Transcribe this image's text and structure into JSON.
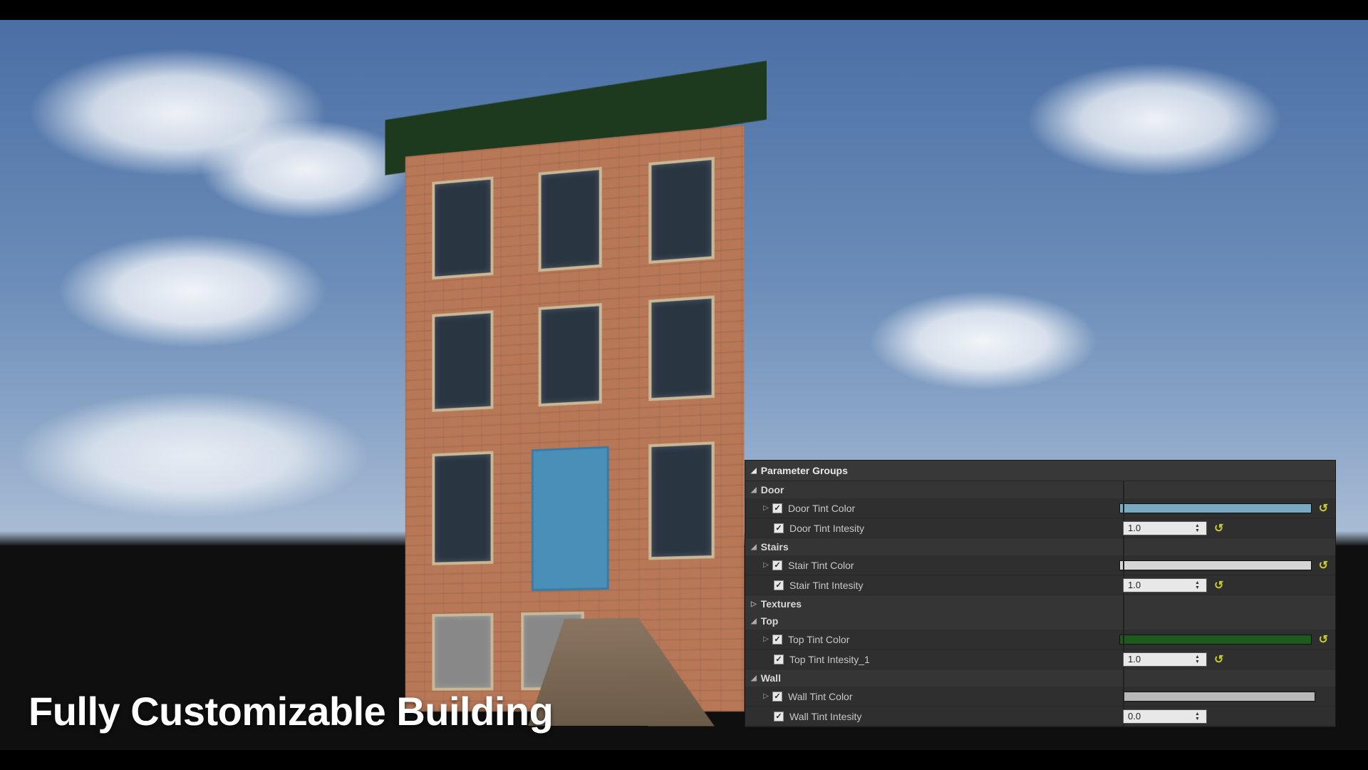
{
  "overlay_title": "Fully Customizable Building",
  "panel": {
    "title": "Parameter Groups",
    "sections": [
      {
        "name": "Door",
        "expanded": true,
        "params": [
          {
            "label": "Door Tint Color",
            "checked": true,
            "expandable": true,
            "type": "color",
            "color": "#7aa9c2",
            "reset": true
          },
          {
            "label": "Door Tint Intesity",
            "checked": true,
            "expandable": false,
            "type": "number",
            "value": "1.0",
            "reset": true
          }
        ]
      },
      {
        "name": "Stairs",
        "expanded": true,
        "params": [
          {
            "label": "Stair Tint Color",
            "checked": true,
            "expandable": true,
            "type": "color",
            "color": "#d6d6d6",
            "reset": true
          },
          {
            "label": "Stair Tint Intesity",
            "checked": true,
            "expandable": false,
            "type": "number",
            "value": "1.0",
            "reset": true
          }
        ]
      },
      {
        "name": "Textures",
        "expanded": false,
        "params": []
      },
      {
        "name": "Top",
        "expanded": true,
        "params": [
          {
            "label": "Top Tint Color",
            "checked": true,
            "expandable": true,
            "type": "color",
            "color": "#1e5a1e",
            "reset": true
          },
          {
            "label": "Top Tint Intesity_1",
            "checked": true,
            "expandable": false,
            "type": "number",
            "value": "1.0",
            "reset": true
          }
        ]
      },
      {
        "name": "Wall",
        "expanded": true,
        "params": [
          {
            "label": "Wall Tint Color",
            "checked": true,
            "expandable": true,
            "type": "color",
            "#": "",
            "color": "#b8b8b8",
            "reset": false
          },
          {
            "label": "Wall Tint Intesity",
            "checked": true,
            "expandable": false,
            "type": "number",
            "value": "0.0",
            "reset": false
          }
        ]
      }
    ]
  }
}
